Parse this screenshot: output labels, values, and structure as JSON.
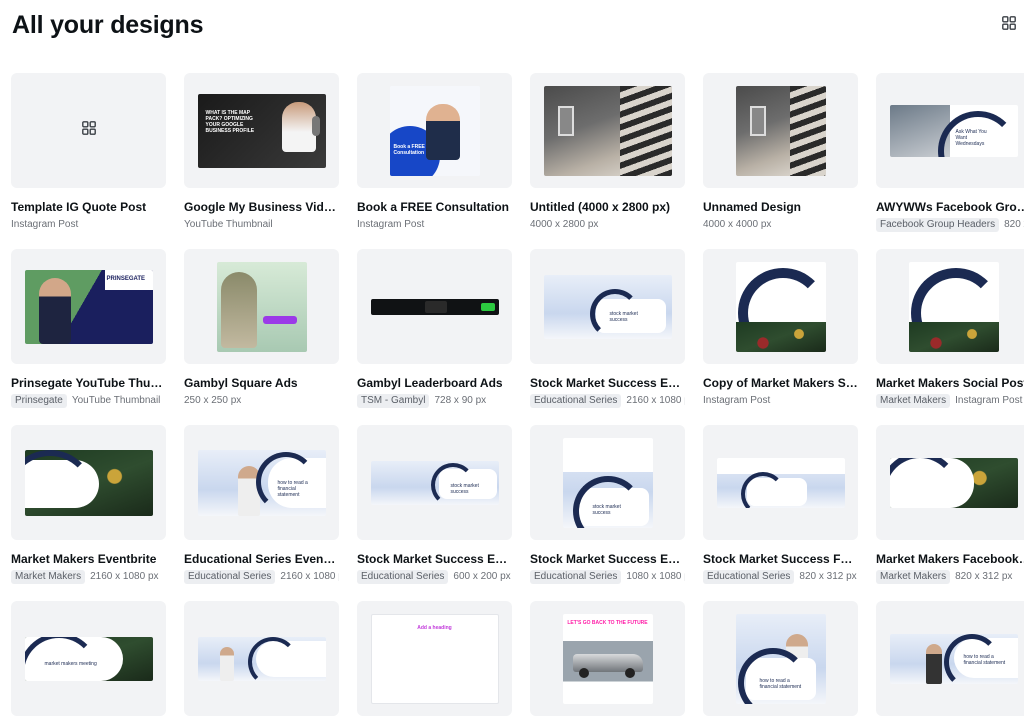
{
  "page": {
    "title": "All your designs"
  },
  "icons": {
    "view_toggle": "grid-icon"
  },
  "designs": [
    {
      "title": "Template IG Quote Post",
      "tag": "",
      "meta": "Instagram Post",
      "thumb": "placeholder-grid"
    },
    {
      "title": "Google My Business Video ...",
      "tag": "",
      "meta": "YouTube Thumbnail",
      "thumb": "dark-video",
      "overlay": "WHAT IS THE MAP PACK? OPTIMIZING YOUR GOOGLE BUSINESS PROFILE"
    },
    {
      "title": "Book a FREE Consultation",
      "tag": "",
      "meta": "Instagram Post",
      "thumb": "blue-consult",
      "overlay": "Book a FREE Consultation"
    },
    {
      "title": "Untitled (4000 x 2800 px)",
      "tag": "",
      "meta": "4000 x 2800 px",
      "thumb": "photo"
    },
    {
      "title": "Unnamed Design",
      "tag": "",
      "meta": "4000 x 4000 px",
      "thumb": "photo"
    },
    {
      "title": "AWYWWs Facebook Group...",
      "tag": "Facebook Group Headers",
      "meta": "820 x",
      "thumb": "awyw",
      "overlay": "Ask What You Want Wednesdays"
    },
    {
      "title": "Prinsegate YouTube Thum...",
      "tag": "Prinsegate",
      "meta": "YouTube Thumbnail",
      "thumb": "prinsegate",
      "overlay": "PRINSEGATE"
    },
    {
      "title": "Gambyl Square Ads",
      "tag": "",
      "meta": "250 x 250 px",
      "thumb": "gambyl-square"
    },
    {
      "title": "Gambyl Leaderboard Ads",
      "tag": "TSM - Gambyl",
      "meta": "728 x 90 px",
      "thumb": "leaderboard"
    },
    {
      "title": "Stock Market Success Eve...",
      "tag": "Educational Series",
      "meta": "2160 x 1080 p",
      "thumb": "blueprint-wide",
      "overlay": "stock market success"
    },
    {
      "title": "Copy of Market Makers So...",
      "tag": "",
      "meta": "Instagram Post",
      "thumb": "mm-square"
    },
    {
      "title": "Market Makers Social Post",
      "tag": "Market Makers",
      "meta": "Instagram Post",
      "thumb": "mm-square"
    },
    {
      "title": "Market Makers Eventbrite",
      "tag": "Market Makers",
      "meta": "2160 x 1080 px",
      "thumb": "mm-wide"
    },
    {
      "title": "Educational Series Eventbr...",
      "tag": "Educational Series",
      "meta": "2160 x 1080 p",
      "thumb": "edu-wide",
      "overlay": "how to read a financial statement"
    },
    {
      "title": "Stock Market Success Ema...",
      "tag": "Educational Series",
      "meta": "600 x 200 px",
      "thumb": "blueprint-banner",
      "overlay": "stock market success"
    },
    {
      "title": "Stock Market Success Eve...",
      "tag": "Educational Series",
      "meta": "1080 x 1080 p",
      "thumb": "blueprint-square",
      "overlay": "stock market success"
    },
    {
      "title": "Stock Market Success Face...",
      "tag": "Educational Series",
      "meta": "820 x 312 px",
      "thumb": "blueprint-fb"
    },
    {
      "title": "Market Makers Facebook ...",
      "tag": "Market Makers",
      "meta": "820 x 312 px",
      "thumb": "mm-fb"
    },
    {
      "title": "",
      "tag": "",
      "meta": "",
      "thumb": "mm-banner",
      "overlay": "market makers meeting"
    },
    {
      "title": "",
      "tag": "",
      "meta": "",
      "thumb": "edu-banner"
    },
    {
      "title": "",
      "tag": "",
      "meta": "",
      "thumb": "heading",
      "overlay": "Add a heading"
    },
    {
      "title": "",
      "tag": "",
      "meta": "",
      "thumb": "car",
      "overlay": "LET'S GO BACK TO THE FUTURE"
    },
    {
      "title": "",
      "tag": "",
      "meta": "",
      "thumb": "edu-square",
      "overlay": "how to read a financial statement"
    },
    {
      "title": "",
      "tag": "",
      "meta": "",
      "thumb": "edu-fb",
      "overlay": "how to read a financial statement"
    }
  ]
}
